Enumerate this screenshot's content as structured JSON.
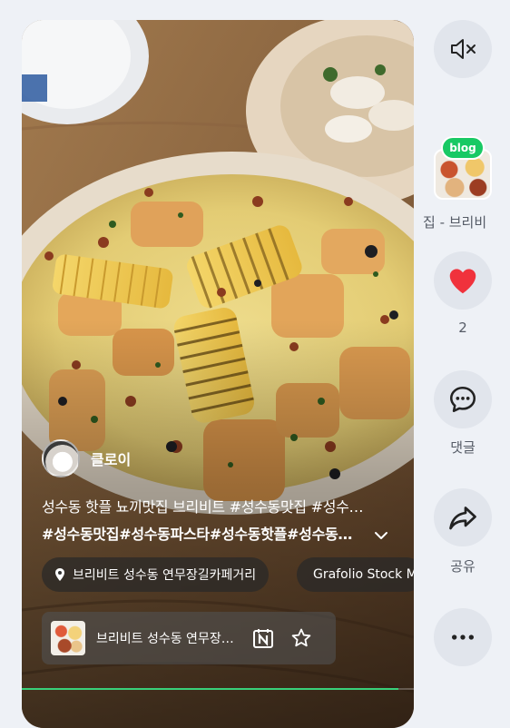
{
  "video": {
    "author_name": "클로이",
    "caption": "성수동 핫플 뇨끼맛집 브리비트 #성수동맛집 #성수동파스타 #성수동핫플",
    "hashtags": "#성수동맛집#성수동파스타#성수동핫플#성수동데이트",
    "place_chip": "브리비트 성수동 연무장길카페거리",
    "music_chip": "Grafolio Stock Music",
    "bottom_bar": {
      "title": "브리비트 성수동 연무장길카페거리"
    },
    "progress_fraction": 0.96,
    "icons": {
      "location": "location-pin-icon",
      "music": "music-note-icon",
      "expand": "chevron-down-icon",
      "naver_calendar": "naver-calendar-icon",
      "favorite": "star-icon"
    }
  },
  "rail": {
    "mute_icon": "speaker-muted-icon",
    "blog": {
      "badge": "blog",
      "label": "집 - 브리비"
    },
    "like": {
      "count": "2",
      "icon": "heart-icon",
      "color": "#f0323c"
    },
    "comment": {
      "label": "댓글",
      "icon": "comment-icon"
    },
    "share": {
      "label": "공유",
      "icon": "share-icon"
    },
    "more_icon": "more-icon"
  },
  "colors": {
    "background": "#eef1f6",
    "rail_button": "#e1e5ec",
    "accent_green": "#18c964",
    "progress": "#39d07a"
  }
}
